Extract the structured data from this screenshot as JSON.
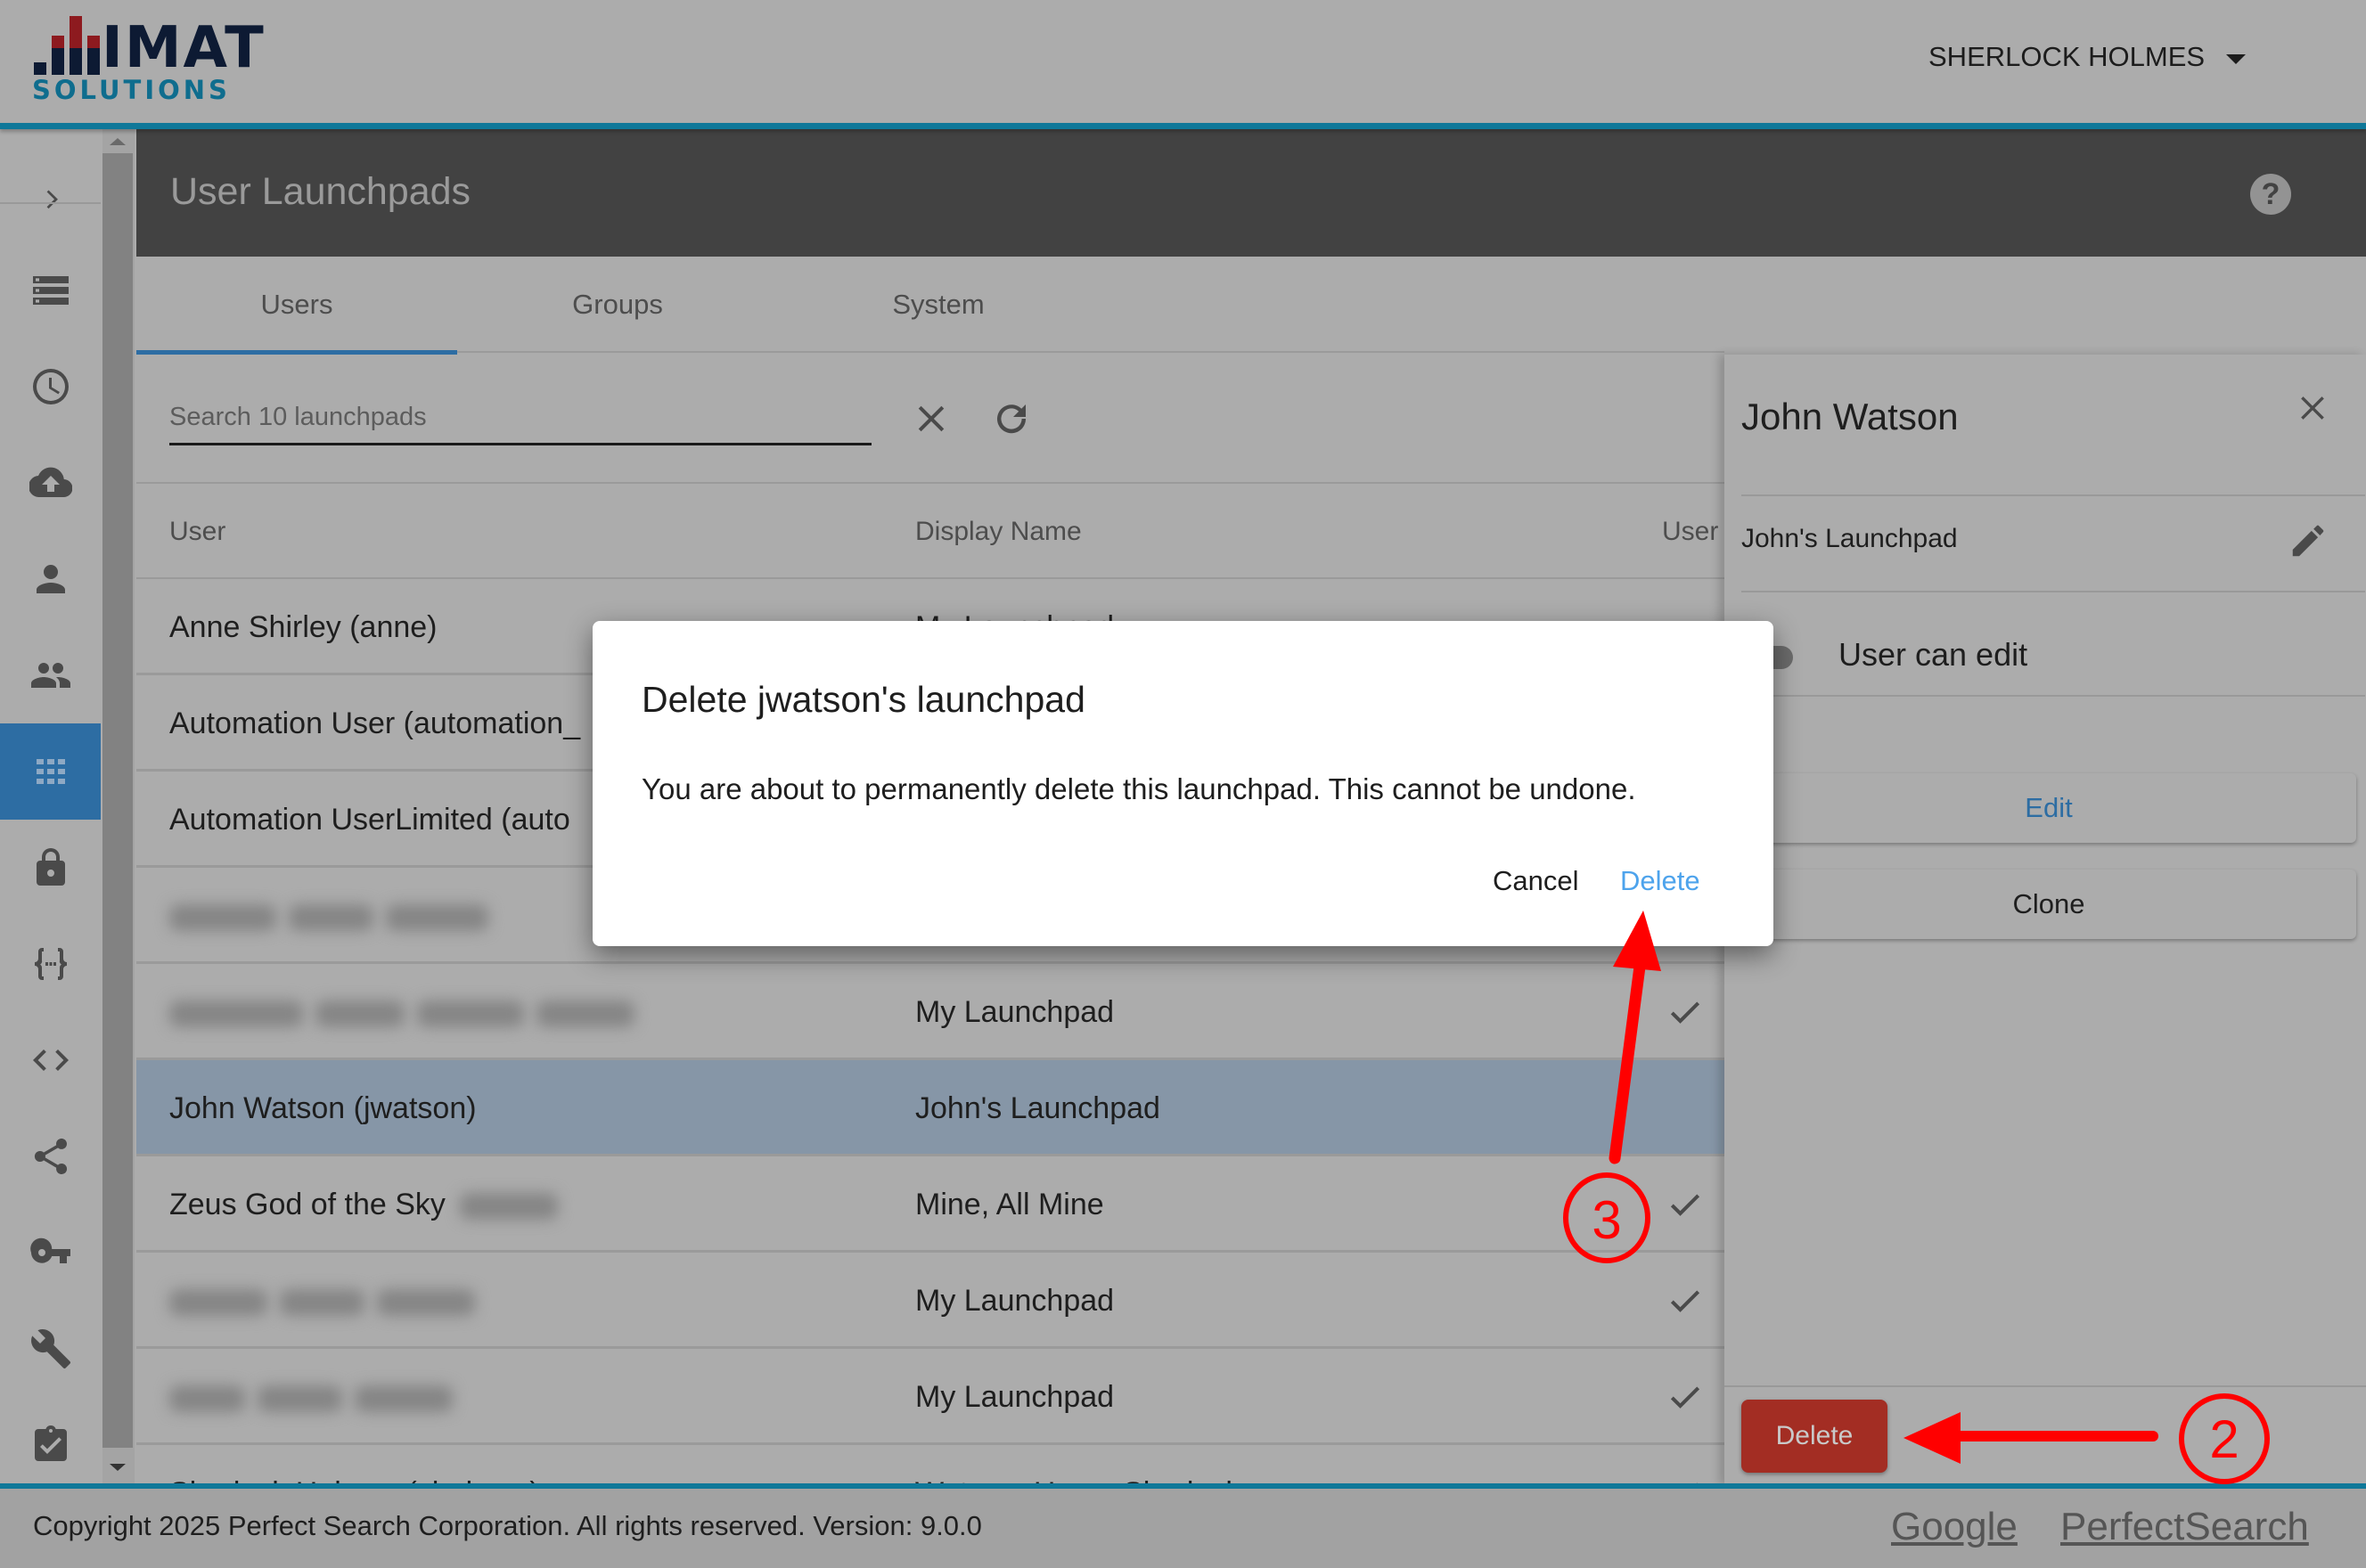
{
  "app": {
    "logo_main": "IMAT",
    "logo_sub": "SOLUTIONS",
    "user_menu": "SHERLOCK HOLMES"
  },
  "sidebar": {
    "items": [
      {
        "icon": "chevron-right-icon",
        "label": "Expand"
      },
      {
        "icon": "list-icon",
        "label": "Lists"
      },
      {
        "icon": "clock-icon",
        "label": "History"
      },
      {
        "icon": "cloud-upload-icon",
        "label": "Upload"
      },
      {
        "icon": "person-icon",
        "label": "Users"
      },
      {
        "icon": "people-icon",
        "label": "Groups"
      },
      {
        "icon": "apps-grid-icon",
        "label": "Launchpads",
        "active": true
      },
      {
        "icon": "lock-icon",
        "label": "Security"
      },
      {
        "icon": "braces-icon",
        "label": "Variables"
      },
      {
        "icon": "code-icon",
        "label": "Code"
      },
      {
        "icon": "share-icon",
        "label": "Sharing"
      },
      {
        "icon": "key-icon",
        "label": "Keys"
      },
      {
        "icon": "wrench-icon",
        "label": "Tools"
      },
      {
        "icon": "clipboard-check-icon",
        "label": "Tasks"
      }
    ]
  },
  "page": {
    "title": "User Launchpads",
    "help_label": "?"
  },
  "tabs": [
    {
      "label": "Users",
      "active": true
    },
    {
      "label": "Groups",
      "active": false
    },
    {
      "label": "System",
      "active": false
    }
  ],
  "search": {
    "placeholder": "Search 10 launchpads",
    "value": ""
  },
  "table": {
    "columns": [
      "User",
      "Display Name",
      "User"
    ],
    "rows": [
      {
        "user": "Anne Shirley (anne)",
        "display_name": "My Launchpad",
        "user_can_edit": false,
        "redacted": false
      },
      {
        "user": "Automation User (automation_",
        "display_name": "",
        "user_can_edit": false,
        "redacted": false
      },
      {
        "user": "Automation UserLimited (auto",
        "display_name": "",
        "user_can_edit": false,
        "redacted": false
      },
      {
        "user": "",
        "display_name": "",
        "user_can_edit": false,
        "redacted": true
      },
      {
        "user": "",
        "display_name": "My Launchpad",
        "user_can_edit": true,
        "redacted": true
      },
      {
        "user": "John Watson (jwatson)",
        "display_name": "John's Launchpad",
        "user_can_edit": false,
        "redacted": false,
        "selected": true
      },
      {
        "user": "Zeus God of the Sky",
        "display_name": "Mine, All Mine",
        "user_can_edit": true,
        "redacted": false,
        "partially_redacted": true
      },
      {
        "user": "",
        "display_name": "My Launchpad",
        "user_can_edit": true,
        "redacted": true
      },
      {
        "user": "",
        "display_name": "My Launchpad",
        "user_can_edit": true,
        "redacted": true
      },
      {
        "user": "Sherlock Holmes (sholmes)",
        "display_name": "Watson, Home Sherlock",
        "user_can_edit": true,
        "redacted": false
      }
    ]
  },
  "detail_panel": {
    "title": "John Watson",
    "launchpad_name": "John's Launchpad",
    "user_can_edit_label": "User can edit",
    "user_can_edit": false,
    "edit_label": "Edit",
    "clone_label": "Clone",
    "delete_label": "Delete"
  },
  "dialog": {
    "title": "Delete jwatson's launchpad",
    "body": "You are about to permanently delete this launchpad. This cannot be undone.",
    "cancel_label": "Cancel",
    "confirm_label": "Delete"
  },
  "annotations": [
    {
      "label": "2",
      "target": "detail-delete-button"
    },
    {
      "label": "3",
      "target": "dialog-delete-button"
    }
  ],
  "footer": {
    "copyright": "Copyright 2025 Perfect Search Corporation. All rights reserved. Version: 9.0.0",
    "links": [
      "Google",
      "PerfectSearch"
    ]
  },
  "colors": {
    "brand_blue": "#0f7899",
    "accent_blue": "#2d6da3",
    "danger_red": "#a32d23",
    "dialog_confirm": "#4da3ec",
    "annotation_red": "#ff0000"
  }
}
